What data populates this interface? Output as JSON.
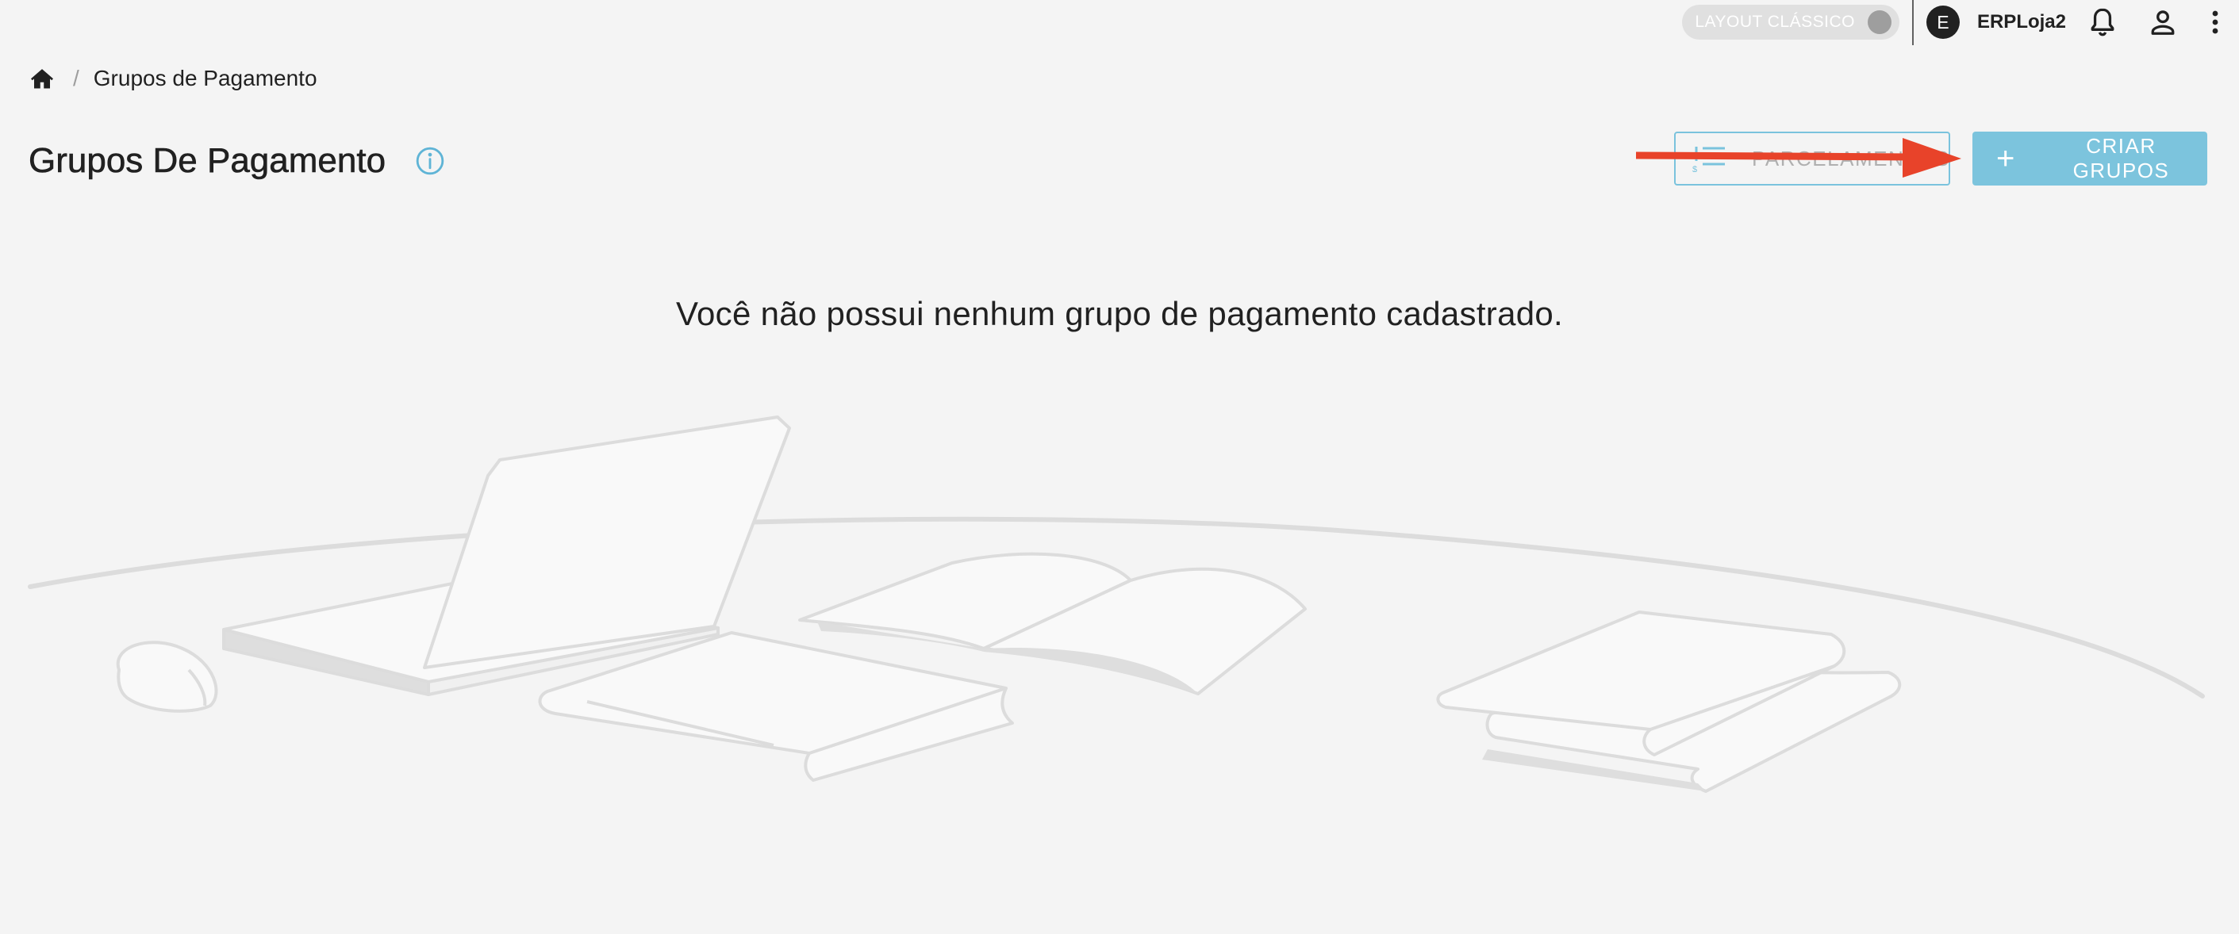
{
  "topbar": {
    "layout_toggle_label": "LAYOUT CLÁSSICO",
    "avatar_initial": "E",
    "store_name": "ERPLoja2",
    "icons": [
      "bell-icon",
      "user-icon",
      "more-vert-icon"
    ]
  },
  "breadcrumb": {
    "home_icon": "home-icon",
    "separator": "/",
    "current": "Grupos de Pagamento"
  },
  "header": {
    "title": "Grupos De Pagamento",
    "info_icon": "info-icon"
  },
  "actions": {
    "installments_label": "PARCELAMENTOS",
    "create_label": "CRIAR GRUPOS",
    "create_icon": "plus-icon"
  },
  "empty_state": {
    "message": "Você não possui nenhum grupo de pagamento cadastrado."
  },
  "colors": {
    "accent": "#7cc4dd",
    "arrow": "#e8432a",
    "background": "#f4f4f4"
  }
}
